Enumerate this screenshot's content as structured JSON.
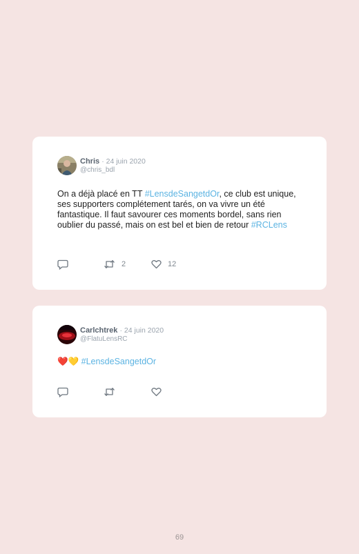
{
  "tweets": [
    {
      "author": "Chris",
      "date": "· 24 juin 2020",
      "handle": "@chris_bdl",
      "text_parts": {
        "p1": "On a déjà placé en TT ",
        "tag1": "#LensdeSangetdOr",
        "p2": ", ce club est unique, ses supporters complétement tarés, on va vivre un été fantastique. Il faut savourer ces moments bordel, sans rien oublier du passé, mais on est bel et bien de retour ",
        "tag2": "#RCLens"
      },
      "retweets": "2",
      "likes": "12"
    },
    {
      "author": "Carlchtrek",
      "date": "· 24 juin 2020",
      "handle": "@FlatuLensRC",
      "emoji": "❤️💛",
      "tag": "#LensdeSangetdOr",
      "retweets": "",
      "likes": ""
    }
  ],
  "icons": {
    "reply": "reply-icon",
    "retweet": "retweet-icon",
    "like": "heart-icon"
  },
  "page_number": "69"
}
